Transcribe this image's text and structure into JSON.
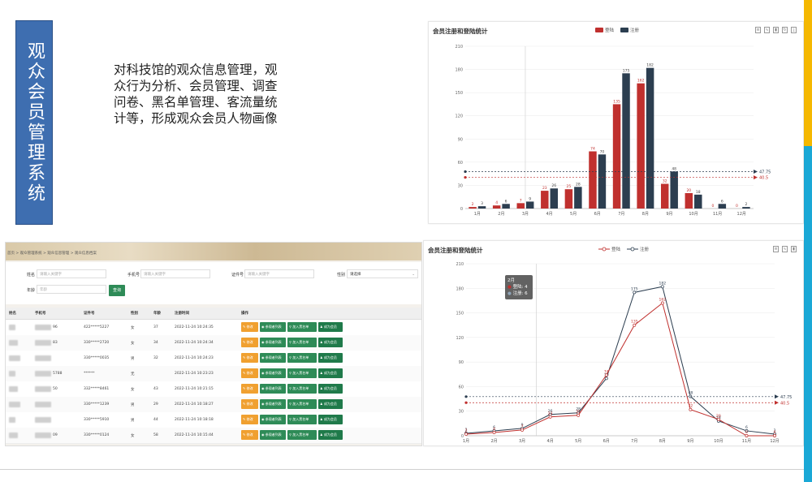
{
  "slide": {
    "vertical_title": "观众会员管理系统",
    "description": "对科技馆的观众信息管理，观众行为分析、会员管理、调查问卷、黑名单管理、客流量统计等，形成观众会员人物画像"
  },
  "colors": {
    "title_bg": "#3e6eb0",
    "login": "#c0302e",
    "register": "#2c3e50",
    "green": "#2e8b57",
    "orange": "#f0a030"
  },
  "bar_chart": {
    "title": "会员注册和登陆统计",
    "legend": [
      "登陆",
      "注册"
    ],
    "tools": [
      "data-view-icon",
      "line-icon",
      "bar-icon",
      "refresh-icon",
      "download-icon"
    ]
  },
  "line_chart": {
    "title": "会员注册和登陆统计",
    "legend": [
      "登陆",
      "注册"
    ],
    "tools": [
      "data-view-icon",
      "line-icon",
      "bar-icon"
    ],
    "tooltip": {
      "title": "2月",
      "line1": "登陆: 4",
      "line2": "注册: 6"
    }
  },
  "chart_data": [
    {
      "type": "bar",
      "title": "会员注册和登陆统计",
      "categories": [
        "1月",
        "2月",
        "3月",
        "4月",
        "5月",
        "6月",
        "7月",
        "8月",
        "9月",
        "10月",
        "11月",
        "12月"
      ],
      "series": [
        {
          "name": "登陆",
          "values": [
            2,
            4,
            7,
            23,
            25,
            74,
            135,
            162,
            32,
            20,
            0,
            0
          ]
        },
        {
          "name": "注册",
          "values": [
            3,
            6,
            9,
            26,
            28,
            70,
            175,
            182,
            48,
            18,
            6,
            2
          ]
        }
      ],
      "ylim": [
        0,
        210
      ],
      "yticks": [
        0,
        30,
        60,
        90,
        120,
        150,
        180,
        210
      ],
      "marklines": [
        {
          "label": "47.75"
        },
        {
          "label": "40.5"
        }
      ]
    },
    {
      "type": "line",
      "title": "会员注册和登陆统计",
      "categories": [
        "1月",
        "2月",
        "3月",
        "4月",
        "5月",
        "6月",
        "7月",
        "8月",
        "9月",
        "10月",
        "11月",
        "12月"
      ],
      "series": [
        {
          "name": "登陆",
          "values": [
            2,
            4,
            7,
            23,
            25,
            74,
            135,
            162,
            32,
            20,
            0,
            0
          ]
        },
        {
          "name": "注册",
          "values": [
            3,
            6,
            9,
            26,
            28,
            70,
            175,
            182,
            48,
            18,
            6,
            2
          ]
        }
      ],
      "ylim": [
        0,
        210
      ],
      "yticks": [
        0,
        30,
        60,
        90,
        120,
        150,
        180,
        210
      ],
      "marklines": [
        {
          "label": "47.75"
        },
        {
          "label": "40.5"
        }
      ]
    }
  ],
  "table_ui": {
    "breadcrumb": "首页 > 观众管理系统 > 观众信息管理 > 观众信息档案",
    "filters": {
      "name_label": "姓名",
      "name_placeholder": "请输入关键字",
      "phone_label": "手机号",
      "phone_placeholder": "请输入关键字",
      "id_label": "证件号",
      "id_placeholder": "请输入关键字",
      "gender_label": "性别",
      "gender_value": "请选择",
      "age_label": "年龄",
      "age_placeholder": "年龄",
      "query_button": "查询"
    },
    "headers": [
      "姓名",
      "手机号",
      "证件号",
      "性别",
      "年龄",
      "注册时间",
      "操作"
    ],
    "actions": [
      "修改",
      "参观者列表",
      "加入黑名单",
      "成为会员"
    ],
    "rows": [
      {
        "phone": "96",
        "id": "422*****5227",
        "gender": "女",
        "age": "37",
        "time": "2022-11-24 10:24:35"
      },
      {
        "phone": "83",
        "id": "330*****2720",
        "gender": "女",
        "age": "34",
        "time": "2022-11-24 10:24:34"
      },
      {
        "phone": "",
        "id": "330*****0035",
        "gender": "男",
        "age": "32",
        "time": "2022-11-24 10:24:23"
      },
      {
        "phone": "5788",
        "id": "******",
        "gender": "无",
        "age": "",
        "time": "2022-11-24 10:23:23"
      },
      {
        "phone": "50",
        "id": "332*****8461",
        "gender": "女",
        "age": "43",
        "time": "2022-11-24 10:21:15"
      },
      {
        "phone": "",
        "id": "330*****1239",
        "gender": "男",
        "age": "29",
        "time": "2022-11-24 10:18:27"
      },
      {
        "phone": "",
        "id": "330*****5910",
        "gender": "男",
        "age": "44",
        "time": "2022-11-24 10:18:18"
      },
      {
        "phone": "09",
        "id": "330*****0124",
        "gender": "女",
        "age": "58",
        "time": "2022-11-24 10:15:44"
      }
    ]
  }
}
